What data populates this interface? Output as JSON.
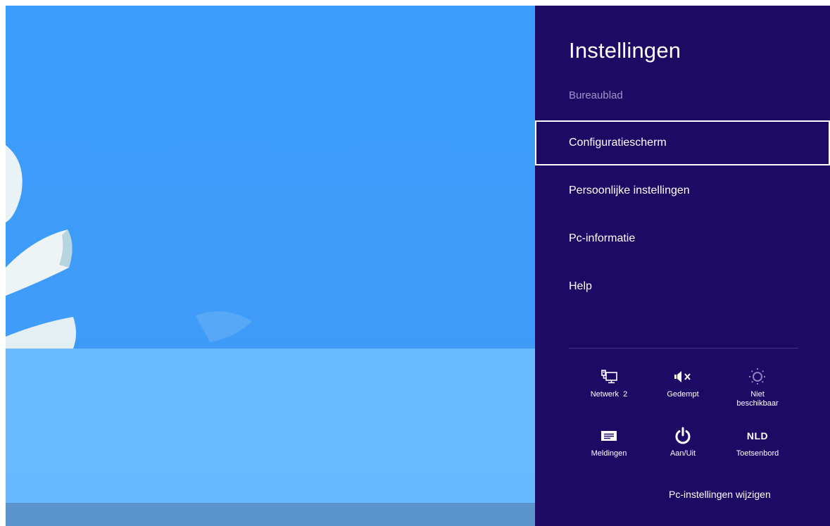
{
  "charm": {
    "title": "Instellingen",
    "subtitle": "Bureaublad",
    "items": [
      {
        "label": "Configuratiescherm",
        "selected": true
      },
      {
        "label": "Persoonlijke instellingen",
        "selected": false
      },
      {
        "label": "Pc-informatie",
        "selected": false
      },
      {
        "label": "Help",
        "selected": false
      }
    ],
    "quick_settings": [
      {
        "icon": "network-icon",
        "label": "Netwerk  2"
      },
      {
        "icon": "volume-muted-icon",
        "label": "Gedempt"
      },
      {
        "icon": "brightness-icon",
        "label": "Niet beschikbaar"
      },
      {
        "icon": "notifications-icon",
        "label": "Meldingen"
      },
      {
        "icon": "power-icon",
        "label": "Aan/Uit"
      },
      {
        "icon": "keyboard-icon",
        "label": "Toetsenbord",
        "glyph": "NLD"
      }
    ],
    "footer_link": "Pc-instellingen wijzigen"
  },
  "colors": {
    "charm_background": "#1d0a65",
    "desktop_background": "#3b9dfb",
    "subtitle": "#9f95c9"
  }
}
